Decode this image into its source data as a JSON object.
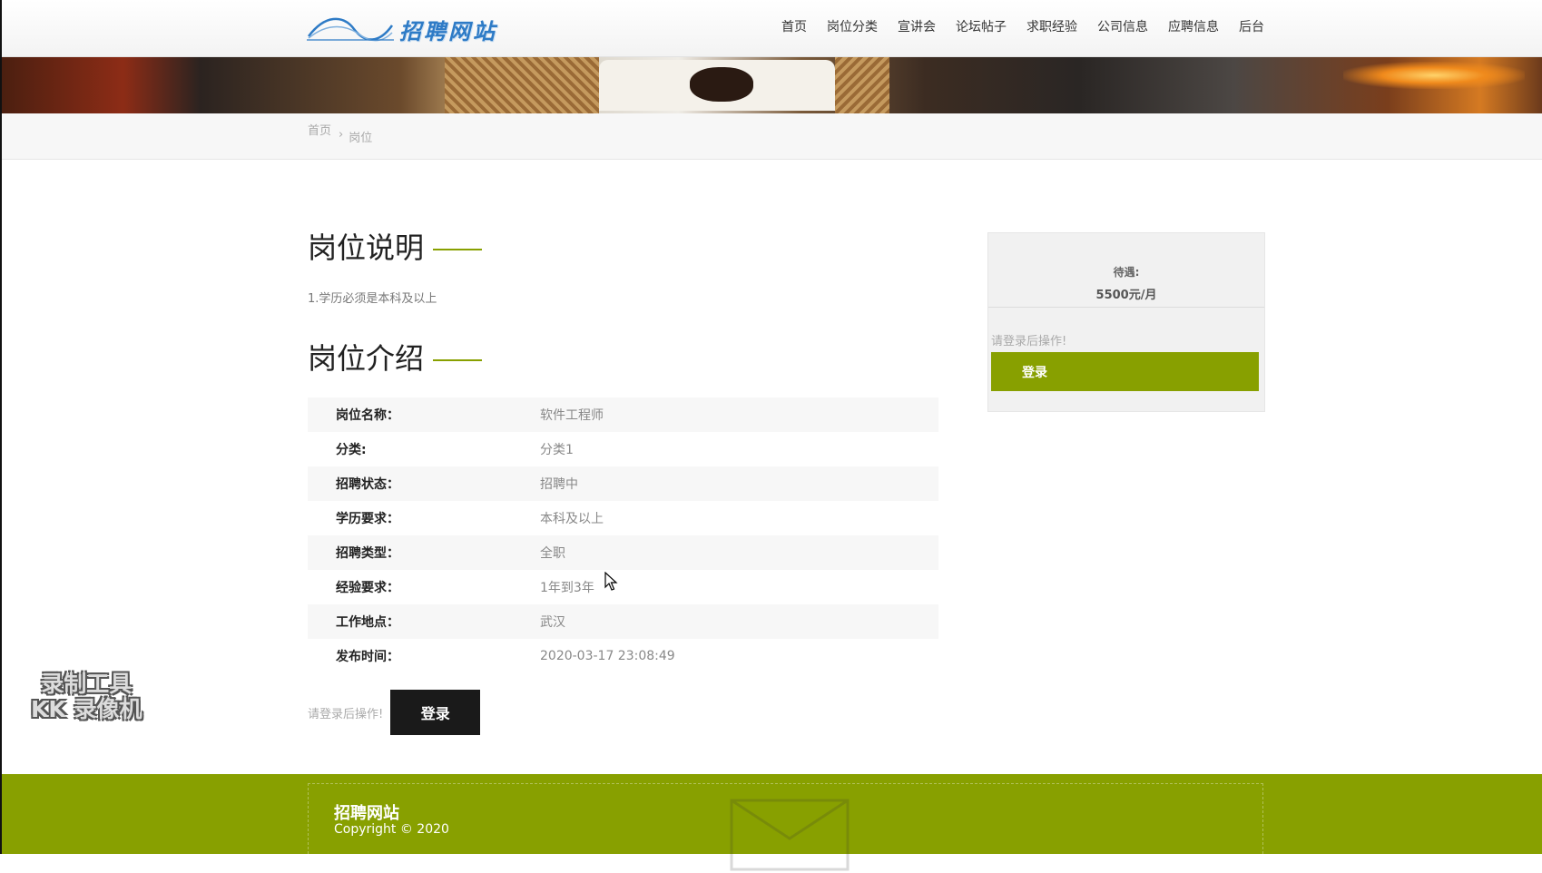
{
  "header": {
    "logo_text": "招聘网站",
    "nav": [
      "首页",
      "岗位分类",
      "宣讲会",
      "论坛帖子",
      "求职经验",
      "公司信息",
      "应聘信息",
      "后台"
    ]
  },
  "breadcrumb": {
    "home": "首页",
    "separator": "›",
    "current": "岗位"
  },
  "main": {
    "section1_title": "岗位说明",
    "description": "1.学历必须是本科及以上",
    "section2_title": "岗位介绍",
    "details": [
      {
        "label": "岗位名称：",
        "value": "软件工程师"
      },
      {
        "label": "分类:",
        "value": "分类1"
      },
      {
        "label": "招聘状态：",
        "value": "招聘中"
      },
      {
        "label": "学历要求：",
        "value": "本科及以上"
      },
      {
        "label": "招聘类型：",
        "value": "全职"
      },
      {
        "label": "经验要求：",
        "value": "1年到3年"
      },
      {
        "label": "工作地点：",
        "value": "武汉"
      },
      {
        "label": "发布时间：",
        "value": "2020-03-17 23:08:49"
      }
    ],
    "login_note": "请登录后操作!",
    "login_button": "登录"
  },
  "sidebar": {
    "salary_label": "待遇:",
    "salary_value": "5500元/月",
    "login_note": "请登录后操作!",
    "login_button": "登录"
  },
  "watermark": {
    "line1": "录制工具",
    "line2": "KK 录像机"
  },
  "footer": {
    "title": "招聘网站",
    "copyright": "Copyright © 2020"
  },
  "colors": {
    "accent": "#88a000",
    "dark_button": "#1a1a1a",
    "logo_blue": "#2e7bc6"
  }
}
